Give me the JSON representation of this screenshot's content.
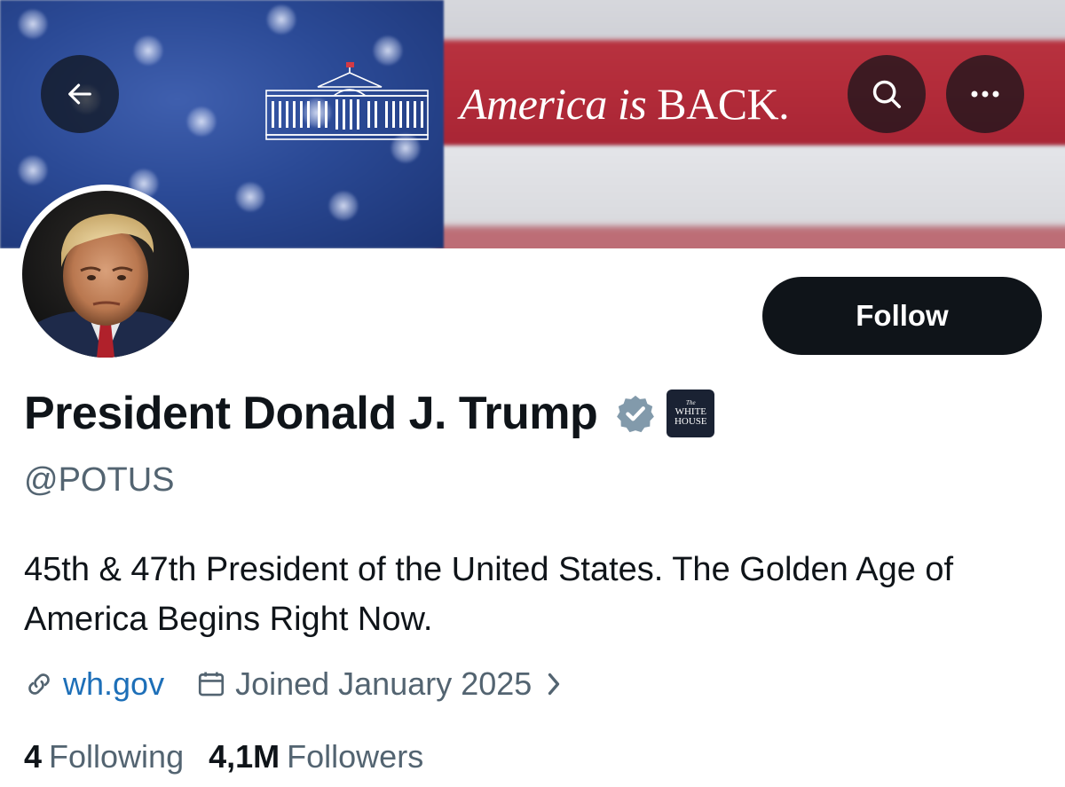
{
  "banner": {
    "tagline_part1": "America is ",
    "tagline_part2": "BACK."
  },
  "nav": {
    "back_icon": "arrow-left-icon",
    "search_icon": "search-icon",
    "more_icon": "more-horizontal-icon"
  },
  "profile": {
    "display_name": "President Donald J. Trump",
    "handle": "@POTUS",
    "verified_icon": "verified-badge-icon",
    "affiliation_badge": {
      "line1": "The",
      "line2": "WHITE",
      "line3": "HOUSE"
    },
    "bio": "45th & 47th President of the United States. The Golden Age of America Begins Right Now.",
    "website": "wh.gov",
    "joined": "Joined January 2025"
  },
  "actions": {
    "follow_label": "Follow"
  },
  "stats": {
    "following_count": "4",
    "following_label": "Following",
    "followers_count": "4,1M",
    "followers_label": "Followers"
  },
  "colors": {
    "text_primary": "#0f1419",
    "text_secondary": "#536471",
    "link": "#1d6fb8",
    "follow_bg": "#0f1419",
    "verified_gray": "#829aab"
  }
}
